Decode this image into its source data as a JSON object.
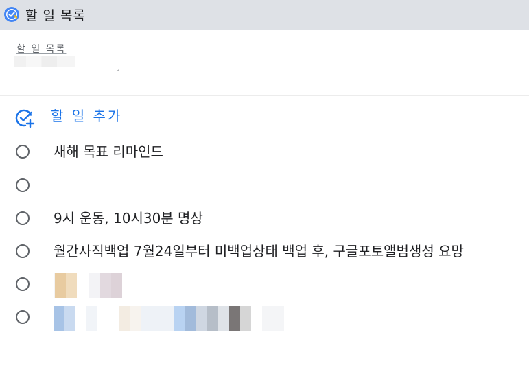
{
  "window": {
    "title": "할 일 목록"
  },
  "list": {
    "name": "할 일 목록",
    "tick": "ˏ"
  },
  "add_task": {
    "label": "할 일 추가"
  },
  "tasks": [
    {
      "title": " 새해 목표 리마인드",
      "completed": false
    },
    {
      "title": "",
      "completed": false
    },
    {
      "title": "9시 운동, 10시30분 명상",
      "completed": false
    },
    {
      "title": "월간사직백업 7월24일부터 미백업상태 백업 후, 구글포토앨범생성 요망",
      "completed": false
    },
    {
      "title": "",
      "completed": false,
      "redacted": true
    },
    {
      "title": "",
      "completed": false,
      "redacted": true
    }
  ],
  "colors": {
    "accent": "#1a73e8",
    "titlebar_bg": "#dee1e6",
    "text": "#202124",
    "secondary_text": "#5f6368"
  }
}
